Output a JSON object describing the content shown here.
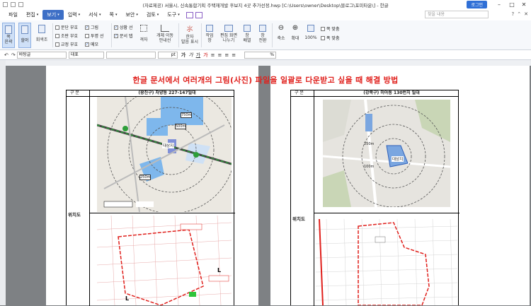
{
  "window": {
    "title": "(자료제공) 서울시, 신속통합기획 주택재개발 후보지 4곳 추가선정.hwp [C:\\Users\\owner\\Desktop\\블로그\\포미타운\\] - 한글",
    "login_label": "로그인",
    "minimize": "–",
    "maximize": "□",
    "close": "✕"
  },
  "menu": {
    "items": [
      "파일",
      "편집",
      "보기",
      "입력",
      "서식",
      "쪽",
      "보안",
      "검토",
      "도구"
    ],
    "active": "보기",
    "help_placeholder": "찾을 내용",
    "right_icons": [
      "?",
      "⌃",
      "✕"
    ]
  },
  "ribbon": {
    "buttons": {
      "page_width": "쪽\n윤곽",
      "full_screen": "할머",
      "comment": "회색조",
      "zoom_out": "축소",
      "zoom_in": "확대",
      "hundred": "100%",
      "arrange": "창\n배열",
      "new_window": "창\n전환",
      "split": "편집 화면\n나누기",
      "work_window": "작업\n창",
      "hanja": "한자\n발음 표시",
      "layout": "격자",
      "grid_move": "개체 이동\n안내선"
    },
    "checks": [
      {
        "label": "문단 부호",
        "checked": false
      },
      {
        "label": "조판 부호",
        "checked": false
      },
      {
        "label": "교정 부호",
        "checked": false
      },
      {
        "label": "그림",
        "checked": true
      },
      {
        "label": "투명 선",
        "checked": false
      },
      {
        "label": "메모",
        "checked": true
      },
      {
        "label": "상황 선",
        "checked": true
      },
      {
        "label": "문서 탭",
        "checked": true
      }
    ],
    "page_options": [
      "쪽 맞춤",
      "폭 맞춤"
    ]
  },
  "format": {
    "style": "바탕글",
    "lang": "대표",
    "font": "",
    "size_unit": "pt",
    "zoom_unit": "%"
  },
  "document": {
    "heading": "한글 문서에서 여러개의 그림(사진) 파일을 일괄로 다운받고 싶을 때 해결 방법",
    "left_table": {
      "col1_header": "구  분",
      "col2_header": "(광진구) 자양동 227-147일대",
      "row_label": "위치도"
    },
    "right_table": {
      "col1_header": "구  분",
      "col2_header": "(강북구) 미아동 130번지 일대",
      "row_label": "위치도"
    },
    "map_labels": {
      "left_site": "대상지",
      "right_site": "대상지",
      "radius_250": "250m",
      "radius_500": "500m",
      "radius_750": "750m",
      "radius_100": "100m"
    }
  },
  "colors": {
    "accent": "#3d6fc6",
    "heading": "#e0201c",
    "ribbon_bg": "#f6f8fb",
    "canvas_bg": "#7e8184"
  }
}
